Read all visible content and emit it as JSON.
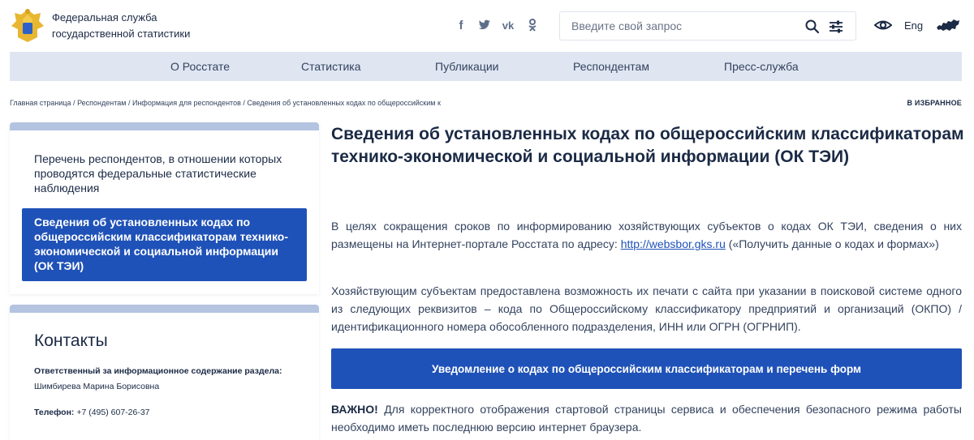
{
  "header": {
    "org_line1": "Федеральная служба",
    "org_line2": "государственной статистики",
    "social": [
      "facebook-icon",
      "twitter-icon",
      "vk-icon",
      "odnoklassniki-icon"
    ],
    "search_placeholder": "Введите свой запрос",
    "lang": "Eng"
  },
  "nav": {
    "items": [
      "О Росстате",
      "Статистика",
      "Публикации",
      "Респондентам",
      "Пресс-служба"
    ]
  },
  "breadcrumb": {
    "items": [
      "Главная страница",
      "Респондентам",
      "Информация для респондентов",
      "Сведения об установленных кодах по общероссийским к"
    ],
    "separator": " / ",
    "favorite": "В ИЗБРАННОЕ"
  },
  "sidebar": {
    "link": "Перечень респондентов, в отношении которых проводятся федеральные статистические наблюдения",
    "active": "Сведения об установленных кодах по общероссийским классификаторам технико-экономической и социальной информации (ОК ТЭИ)",
    "contacts": {
      "title": "Контакты",
      "responsible_label": "Ответственный за информационное содержание раздела:",
      "responsible_name": "Шимбирева Марина Борисовна",
      "phone_label": "Телефон:",
      "phone": "+7 (495) 607-26-37"
    }
  },
  "main": {
    "title": "Сведения об установленных кодах по общероссийским классификаторам технико-экономической и социальной информации (ОК ТЭИ)",
    "para1_before": "В целях сокращения сроков по информированию хозяйствующих субъектов о кодах ОК ТЭИ, сведения о них размещены на Интернет-портале Росстата по адресу: ",
    "para1_link": "http://websbor.gks.ru",
    "para1_after": " («Получить данные о кодах и формах»)",
    "para2": "Хозяйствующим субъектам предоставлена возможность их печати с сайта при указании в поисковой системе одного из следующих реквизитов – кода по Общероссийскому классификатору предприятий и организаций (ОКПО) / идентификационного номера обособленного подразделения, ИНН или ОГРН (ОГРНИП).",
    "button": "Уведомление о кодах по общероссийским классификаторам и перечень форм",
    "important_label": "ВАЖНО!",
    "important_text": " Для корректного отображения стартовой страницы сервиса и обеспечения безопасного режима работы необходимо иметь последнюю версию интернет браузера."
  },
  "colors": {
    "primary": "#1f52b8",
    "nav_bg": "#dfe6f2",
    "card_top": "#b4c3e0",
    "text": "#1b2a45"
  }
}
